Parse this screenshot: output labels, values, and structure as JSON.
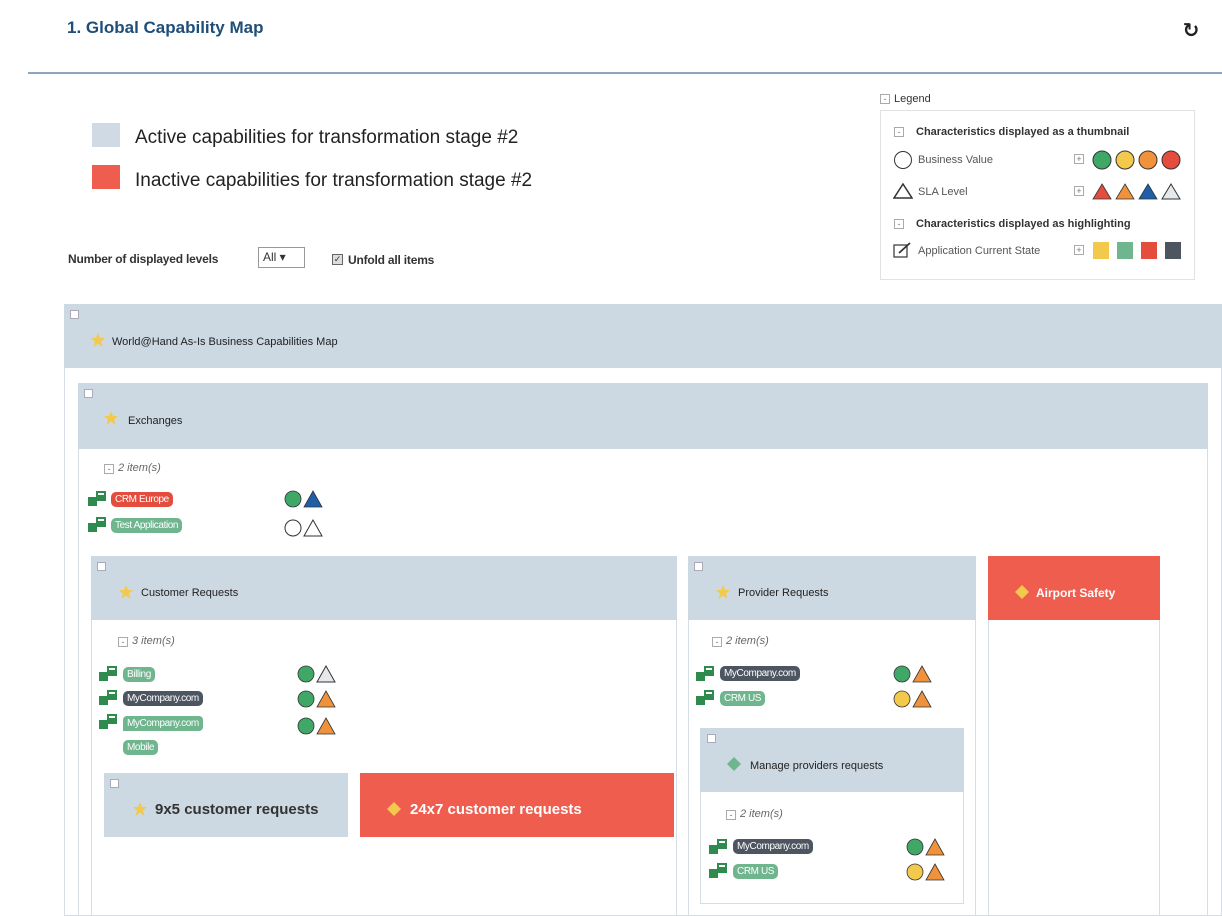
{
  "header": {
    "title": "1. Global Capability Map"
  },
  "stage_legend": [
    {
      "label": "Active capabilities for transformation stage #2",
      "color": "#cfdae4"
    },
    {
      "label": "Inactive capabilities for transformation stage #2",
      "color": "#ee5d4e"
    }
  ],
  "controls": {
    "levels_label": "Number of displayed levels",
    "levels_value": "All ▾",
    "unfold_label": "Unfold all items"
  },
  "legend": {
    "title": "Legend",
    "thumbnail_title": "Characteristics displayed as a thumbnail",
    "business_value": "Business Value",
    "sla_level": "SLA Level",
    "highlight_title": "Characteristics displayed as highlighting",
    "app_state": "Application Current State",
    "bv_colors": [
      "#3fa867",
      "#f2c94c",
      "#f0923b",
      "#e44c3d"
    ],
    "sla_colors": [
      "#e44c3d",
      "#f0923b",
      "#1f5fa8",
      "#9aa3ad"
    ],
    "state_colors": [
      "#f2c94c",
      "#6fb58e",
      "#e44c3d",
      "#4d5560"
    ]
  },
  "map": {
    "root": "World@Hand As-Is Business Capabilities Map",
    "exchanges": {
      "name": "Exchanges",
      "count": "2 item(s)",
      "apps": [
        "CRM Europe",
        "Test Application"
      ]
    },
    "customer_requests": {
      "name": "Customer Requests",
      "count": "3 item(s)",
      "apps": [
        "Billing",
        "MyCompany.com",
        "MyCompany.com",
        "Mobile"
      ]
    },
    "provider_requests": {
      "name": "Provider Requests",
      "count": "2 item(s)",
      "apps": [
        "MyCompany.com",
        "CRM US"
      ]
    },
    "airport_safety": {
      "name": "Airport Safety"
    },
    "manage_providers": {
      "name": "Manage providers requests",
      "count": "2 item(s)",
      "apps": [
        "MyCompany.com",
        "CRM US"
      ]
    },
    "cust_9x5": {
      "name": "9x5 customer requests"
    },
    "cust_24x7": {
      "name": "24x7 customer requests"
    }
  }
}
